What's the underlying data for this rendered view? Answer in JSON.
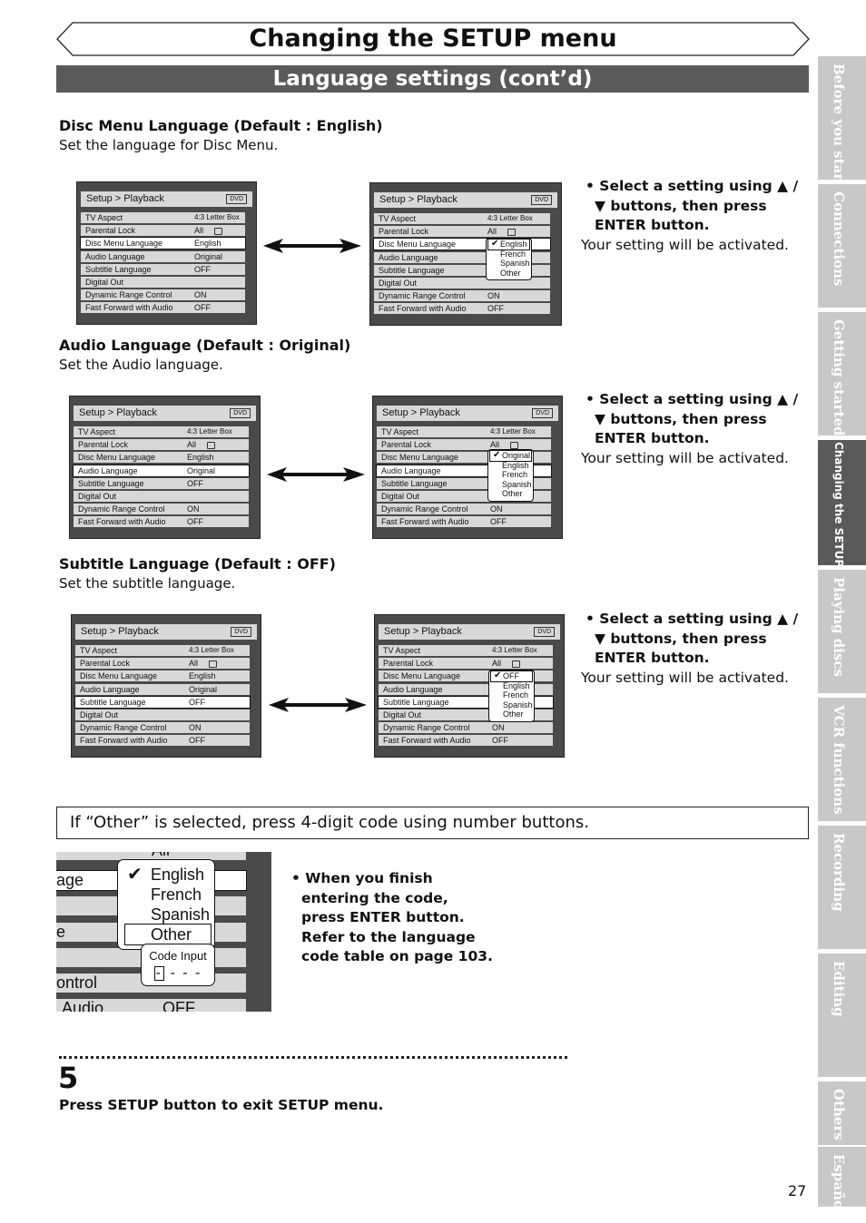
{
  "page_title": "Changing the SETUP menu",
  "section_title": "Language settings (cont’d)",
  "common": {
    "screen_header": "Setup > Playback",
    "dvd_badge": "DVD",
    "select_instruction": "• Select a setting using ▲ / ▼ buttons, then press ENTER button.",
    "activated_note": "Your setting will be activated."
  },
  "disc_menu": {
    "heading": "Disc Menu Language (Default : English)",
    "desc": "Set the language for Disc Menu.",
    "left_rows": [
      {
        "label": "TV Aspect",
        "value": "4:3 Letter Box"
      },
      {
        "label": "Parental Lock",
        "value": "All"
      },
      {
        "label": "Disc Menu Language",
        "value": "English"
      },
      {
        "label": "Audio Language",
        "value": "Original"
      },
      {
        "label": "Subtitle Language",
        "value": "OFF"
      },
      {
        "label": "Digital Out",
        "value": ""
      },
      {
        "label": "Dynamic Range Control",
        "value": "ON"
      },
      {
        "label": "Fast Forward with Audio",
        "value": "OFF"
      }
    ],
    "right_rows": [
      {
        "label": "TV Aspect",
        "value": "4:3 Letter Box"
      },
      {
        "label": "Parental Lock",
        "value": "All"
      },
      {
        "label": "Disc Menu Language",
        "value": ""
      },
      {
        "label": "Audio Language",
        "value": ""
      },
      {
        "label": "Subtitle Language",
        "value": ""
      },
      {
        "label": "Digital Out",
        "value": ""
      },
      {
        "label": "Dynamic Range Control",
        "value": "ON"
      },
      {
        "label": "Fast Forward with Audio",
        "value": "OFF"
      }
    ],
    "options": [
      "English",
      "French",
      "Spanish",
      "Other"
    ]
  },
  "audio": {
    "heading": "Audio Language (Default : Original)",
    "desc": "Set the Audio language.",
    "left_rows": [
      {
        "label": "TV Aspect",
        "value": "4:3 Letter Box"
      },
      {
        "label": "Parental Lock",
        "value": "All"
      },
      {
        "label": "Disc Menu Language",
        "value": "English"
      },
      {
        "label": "Audio Language",
        "value": "Original"
      },
      {
        "label": "Subtitle Language",
        "value": "OFF"
      },
      {
        "label": "Digital Out",
        "value": ""
      },
      {
        "label": "Dynamic Range Control",
        "value": "ON"
      },
      {
        "label": "Fast Forward with Audio",
        "value": "OFF"
      }
    ],
    "right_rows": [
      {
        "label": "TV Aspect",
        "value": "4:3 Letter Box"
      },
      {
        "label": "Parental Lock",
        "value": "All"
      },
      {
        "label": "Disc Menu Language",
        "value": ""
      },
      {
        "label": "Audio Language",
        "value": ""
      },
      {
        "label": "Subtitle Language",
        "value": ""
      },
      {
        "label": "Digital Out",
        "value": ""
      },
      {
        "label": "Dynamic Range Control",
        "value": "ON"
      },
      {
        "label": "Fast Forward with Audio",
        "value": "OFF"
      }
    ],
    "options": [
      "Original",
      "English",
      "French",
      "Spanish",
      "Other"
    ]
  },
  "subtitle": {
    "heading": "Subtitle Language (Default : OFF)",
    "desc": "Set the subtitle language.",
    "left_rows": [
      {
        "label": "TV Aspect",
        "value": "4:3 Letter Box"
      },
      {
        "label": "Parental Lock",
        "value": "All"
      },
      {
        "label": "Disc Menu Language",
        "value": "English"
      },
      {
        "label": "Audio Language",
        "value": "Original"
      },
      {
        "label": "Subtitle Language",
        "value": "OFF"
      },
      {
        "label": "Digital Out",
        "value": ""
      },
      {
        "label": "Dynamic Range Control",
        "value": "ON"
      },
      {
        "label": "Fast Forward with Audio",
        "value": "OFF"
      }
    ],
    "right_rows": [
      {
        "label": "TV Aspect",
        "value": "4:3 Letter Box"
      },
      {
        "label": "Parental Lock",
        "value": "All"
      },
      {
        "label": "Disc Menu Language",
        "value": "English"
      },
      {
        "label": "Audio Language",
        "value": "Original"
      },
      {
        "label": "Subtitle Language",
        "value": ""
      },
      {
        "label": "Digital Out",
        "value": ""
      },
      {
        "label": "Dynamic Range Control",
        "value": "ON"
      },
      {
        "label": "Fast Forward with Audio",
        "value": "OFF"
      }
    ],
    "options": [
      "OFF",
      "English",
      "French",
      "Spanish",
      "Other"
    ]
  },
  "other": {
    "note": "If “Other” is selected, press 4-digit code using number buttons.",
    "zoom_rows": [
      "All",
      "age",
      "",
      "e",
      "",
      "ontrol",
      "Audio OFF"
    ],
    "zoom_options": [
      "English",
      "French",
      "Spanish",
      "Other"
    ],
    "code_label": "Code Input",
    "code_digits": "- - - -",
    "when_text": "• When you finish entering the code, press ENTER button. Refer to the language code table on page 103."
  },
  "step": {
    "number": "5",
    "text": "Press SETUP button to exit SETUP menu."
  },
  "side_tabs": [
    "Before you start",
    "Connections",
    "Getting started",
    "Changing the SETUP menu",
    "Playing discs",
    "VCR functions",
    "Recording",
    "Editing",
    "Others",
    "Español"
  ],
  "page_number": "27"
}
